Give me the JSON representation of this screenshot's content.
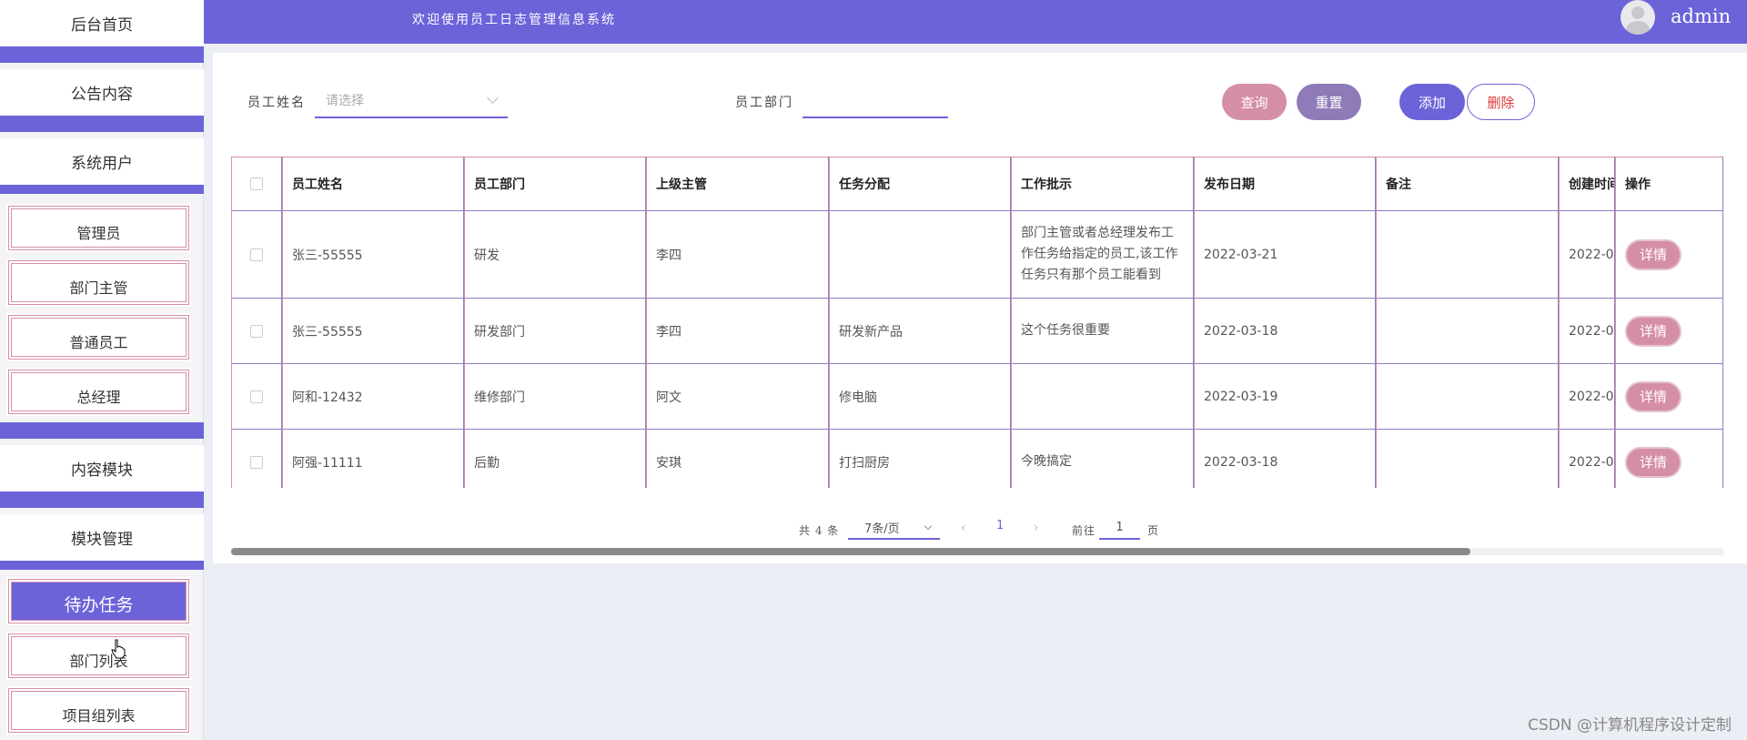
{
  "sidebar": {
    "home": "后台首页",
    "notice": "公告内容",
    "system_users": "系统用户",
    "user_items": [
      "管理员",
      "部门主管",
      "普通员工",
      "总经理"
    ],
    "content_module": "内容模块",
    "module_manage": "模块管理",
    "module_items": [
      "待办任务",
      "部门列表",
      "项目组列表"
    ],
    "active_item": "待办任务"
  },
  "header": {
    "welcome": "欢迎使用员工日志管理信息系统",
    "user": "admin"
  },
  "search": {
    "name_label": "员工姓名",
    "name_placeholder": "请选择",
    "dept_label": "员工部门",
    "dept_value": "",
    "query_label": "查询",
    "reset_label": "重置",
    "add_label": "添加",
    "delete_label": "删除"
  },
  "table": {
    "headers": [
      "员工姓名",
      "员工部门",
      "上级主管",
      "任务分配",
      "工作批示",
      "发布日期",
      "备注",
      "创建时间",
      "操作"
    ],
    "detail_label": "详情",
    "rows": [
      [
        "张三-55555",
        "研发",
        "李四",
        "",
        "部门主管或者总经理发布工作任务给指定的员工,该工作任务只有那个员工能看到",
        "2022-03-21",
        "",
        "2022-0"
      ],
      [
        "张三-55555",
        "研发部门",
        "李四",
        "研发新产品",
        "这个任务很重要",
        "2022-03-18",
        "",
        "2022-0"
      ],
      [
        "阿和-12432",
        "维修部门",
        "阿文",
        "修电脑",
        "",
        "2022-03-19",
        "",
        "2022-0"
      ],
      [
        "阿强-11111",
        "后勤",
        "安琪",
        "打扫厨房",
        "今晚搞定",
        "2022-03-18",
        "",
        "2022-0"
      ]
    ]
  },
  "pagination": {
    "total_text": "共 4 条",
    "page_size": "7条/页",
    "prev_icon": "‹",
    "next_icon": "›",
    "current_page": "1",
    "goto_label": "前往",
    "goto_value": "1",
    "page_unit": "页"
  },
  "watermark": "CSDN @计算机程序设计定制",
  "colors": {
    "primary": "#6c63d9",
    "pink": "#d58ea8",
    "muted_purple": "#8e7bb8",
    "danger": "#e0393e"
  }
}
